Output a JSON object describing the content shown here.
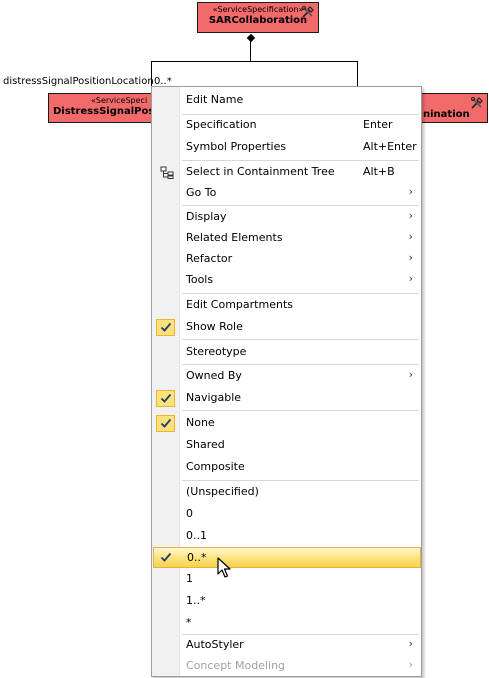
{
  "diagram": {
    "top_box": {
      "stereotype": "«ServiceSpecification»",
      "name": "SARCollaboration"
    },
    "left_box": {
      "stereotype": "«ServiceSpeci",
      "name": "DistressSignalPos"
    },
    "right_box": {
      "name": "nination"
    },
    "assoc_role": "distressSignalPositionLocation",
    "assoc_mult": "0..*",
    "box_color": "#f26a6a"
  },
  "menu": {
    "items": [
      {
        "label": "Edit Name"
      },
      {
        "label": "Specification",
        "shortcut": "Enter"
      },
      {
        "label": "Symbol Properties",
        "shortcut": "Alt+Enter"
      },
      {
        "label": "Select in Containment Tree",
        "shortcut": "Alt+B",
        "icon": "containment-tree-icon"
      },
      {
        "label": "Go To",
        "submenu": true
      },
      {
        "label": "Display",
        "submenu": true
      },
      {
        "label": "Related Elements",
        "submenu": true
      },
      {
        "label": "Refactor",
        "submenu": true
      },
      {
        "label": "Tools",
        "submenu": true
      },
      {
        "label": "Edit Compartments"
      },
      {
        "label": "Show Role",
        "checked": true
      },
      {
        "label": "Stereotype"
      },
      {
        "label": "Owned By",
        "submenu": true
      },
      {
        "label": "Navigable",
        "checked": true
      },
      {
        "label": "None",
        "checked": true
      },
      {
        "label": "Shared"
      },
      {
        "label": "Composite"
      },
      {
        "label": "(Unspecified)"
      },
      {
        "label": "0"
      },
      {
        "label": "0..1"
      },
      {
        "label": "0..*",
        "checked": true,
        "highlighted": true
      },
      {
        "label": "1"
      },
      {
        "label": "1..*"
      },
      {
        "label": "*"
      },
      {
        "label": "AutoStyler",
        "submenu": true
      },
      {
        "label": "Concept Modeling",
        "submenu": true,
        "disabled": true
      }
    ],
    "submenu_arrow": "›",
    "highlight_color": "#fde27a"
  }
}
